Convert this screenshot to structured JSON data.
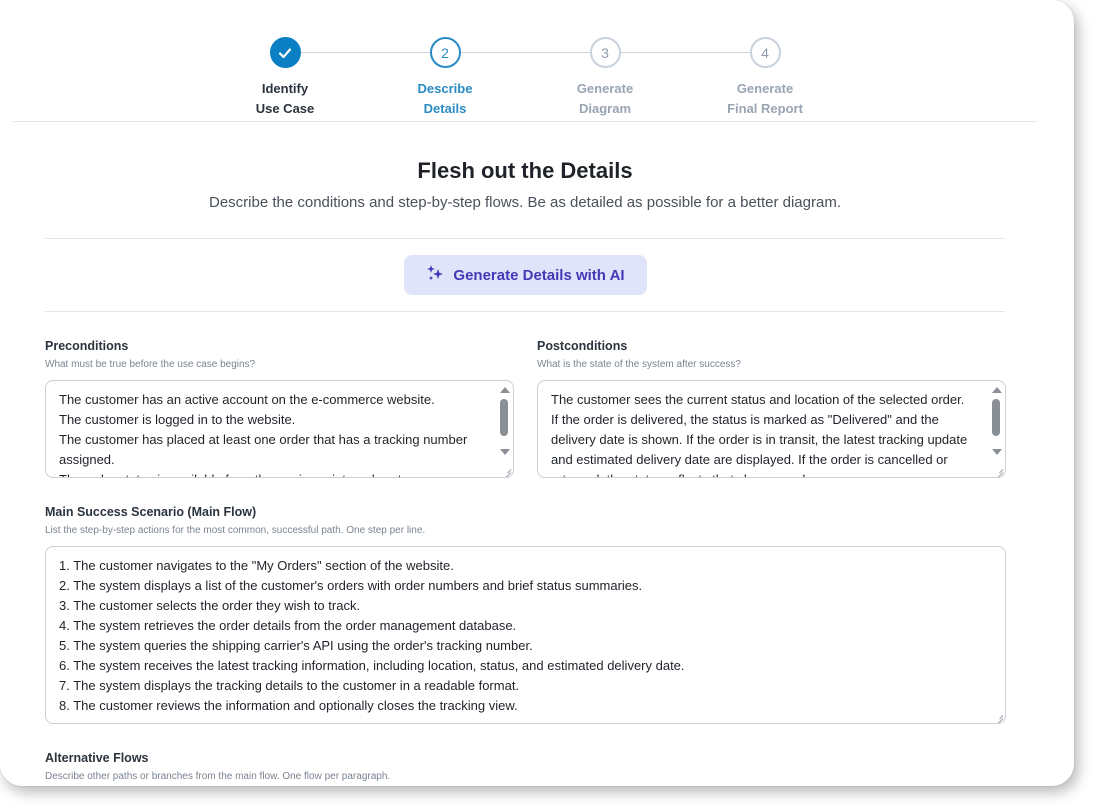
{
  "stepper": {
    "steps": [
      {
        "number": "",
        "line1": "Identify",
        "line2": "Use Case",
        "state": "done"
      },
      {
        "number": "2",
        "line1": "Describe",
        "line2": "Details",
        "state": "active"
      },
      {
        "number": "3",
        "line1": "Generate",
        "line2": "Diagram",
        "state": "pending"
      },
      {
        "number": "4",
        "line1": "Generate",
        "line2": "Final Report",
        "state": "pending"
      }
    ]
  },
  "header": {
    "title": "Flesh out the Details",
    "subtitle": "Describe the conditions and step-by-step flows. Be as detailed as possible for a better diagram."
  },
  "ai_button": {
    "label": "Generate Details with AI",
    "icon": "sparkles-icon"
  },
  "preconditions": {
    "label": "Preconditions",
    "hint": "What must be true before the use case begins?",
    "value": "The customer has an active account on the e-commerce website.\nThe customer is logged in to the website.\nThe customer has placed at least one order that has a tracking number assigned.\nThe order status is available from the carrier or internal system."
  },
  "postconditions": {
    "label": "Postconditions",
    "hint": "What is the state of the system after success?",
    "value": "The customer sees the current status and location of the selected order. If the order is delivered, the status is marked as \"Delivered\" and the delivery date is shown. If the order is in transit, the latest tracking update and estimated delivery date are displayed. If the order is cancelled or returned, the status reflects that change and"
  },
  "main_flow": {
    "label": "Main Success Scenario (Main Flow)",
    "hint": "List the step-by-step actions for the most common, successful path. One step per line.",
    "value": "1. The customer navigates to the \"My Orders\" section of the website.\n2. The system displays a list of the customer's orders with order numbers and brief status summaries.\n3. The customer selects the order they wish to track.\n4. The system retrieves the order details from the order management database.\n5. The system queries the shipping carrier's API using the order's tracking number.\n6. The system receives the latest tracking information, including location, status, and estimated delivery date.\n7. The system displays the tracking details to the customer in a readable format.\n8. The customer reviews the information and optionally closes the tracking view."
  },
  "alternative_flows": {
    "label": "Alternative Flows",
    "hint": "Describe other paths or branches from the main flow. One flow per paragraph."
  },
  "colors": {
    "accent": "#0b7fc3",
    "ai_button_bg": "#e0e4fb",
    "ai_button_text": "#4538b6"
  }
}
